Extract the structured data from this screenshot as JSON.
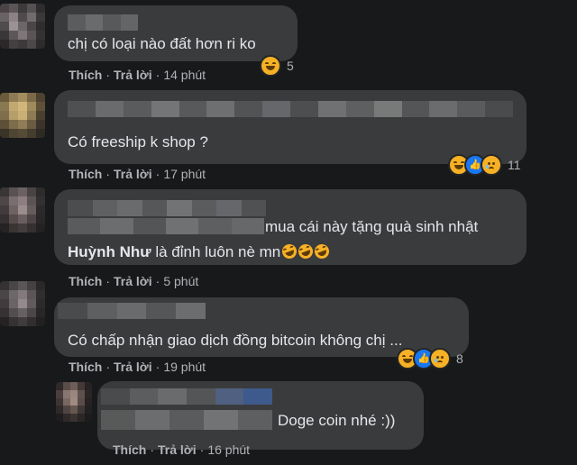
{
  "action_labels": {
    "like": "Thích",
    "reply": "Trả lời",
    "sep": "·"
  },
  "comments": [
    {
      "text": "chị có loại nào đất hơn ri ko",
      "time": "14 phút",
      "reaction_count": "5",
      "reactions": [
        "haha"
      ]
    },
    {
      "text": "Có freeship k shop ?",
      "time": "17 phút",
      "reaction_count": "11",
      "reactions": [
        "haha",
        "like",
        "sad"
      ]
    },
    {
      "text_line1": "mua cái này tặng quà sinh nhật",
      "mention": "Huỳnh Như",
      "text_line2": " là đỉnh luôn nè mn",
      "inline_emojis": [
        "rofl-emoji",
        "rofl-emoji",
        "rofl-emoji"
      ],
      "time": "5 phút"
    },
    {
      "text": "Có chấp nhận giao dịch đồng bitcoin không chị ...",
      "time": "19 phút",
      "reaction_count": "8",
      "reactions": [
        "haha",
        "like",
        "sad"
      ]
    },
    {
      "text": "Doge coin nhé :))",
      "time": "16 phút",
      "is_reply": true
    }
  ],
  "colors": {
    "background": "#18191a",
    "bubble": "#3a3b3c",
    "text": "#e4e6eb",
    "secondary_text": "#b0b3b8",
    "like_blue": "#1877f2",
    "reaction_yellow": "#f7b125"
  }
}
